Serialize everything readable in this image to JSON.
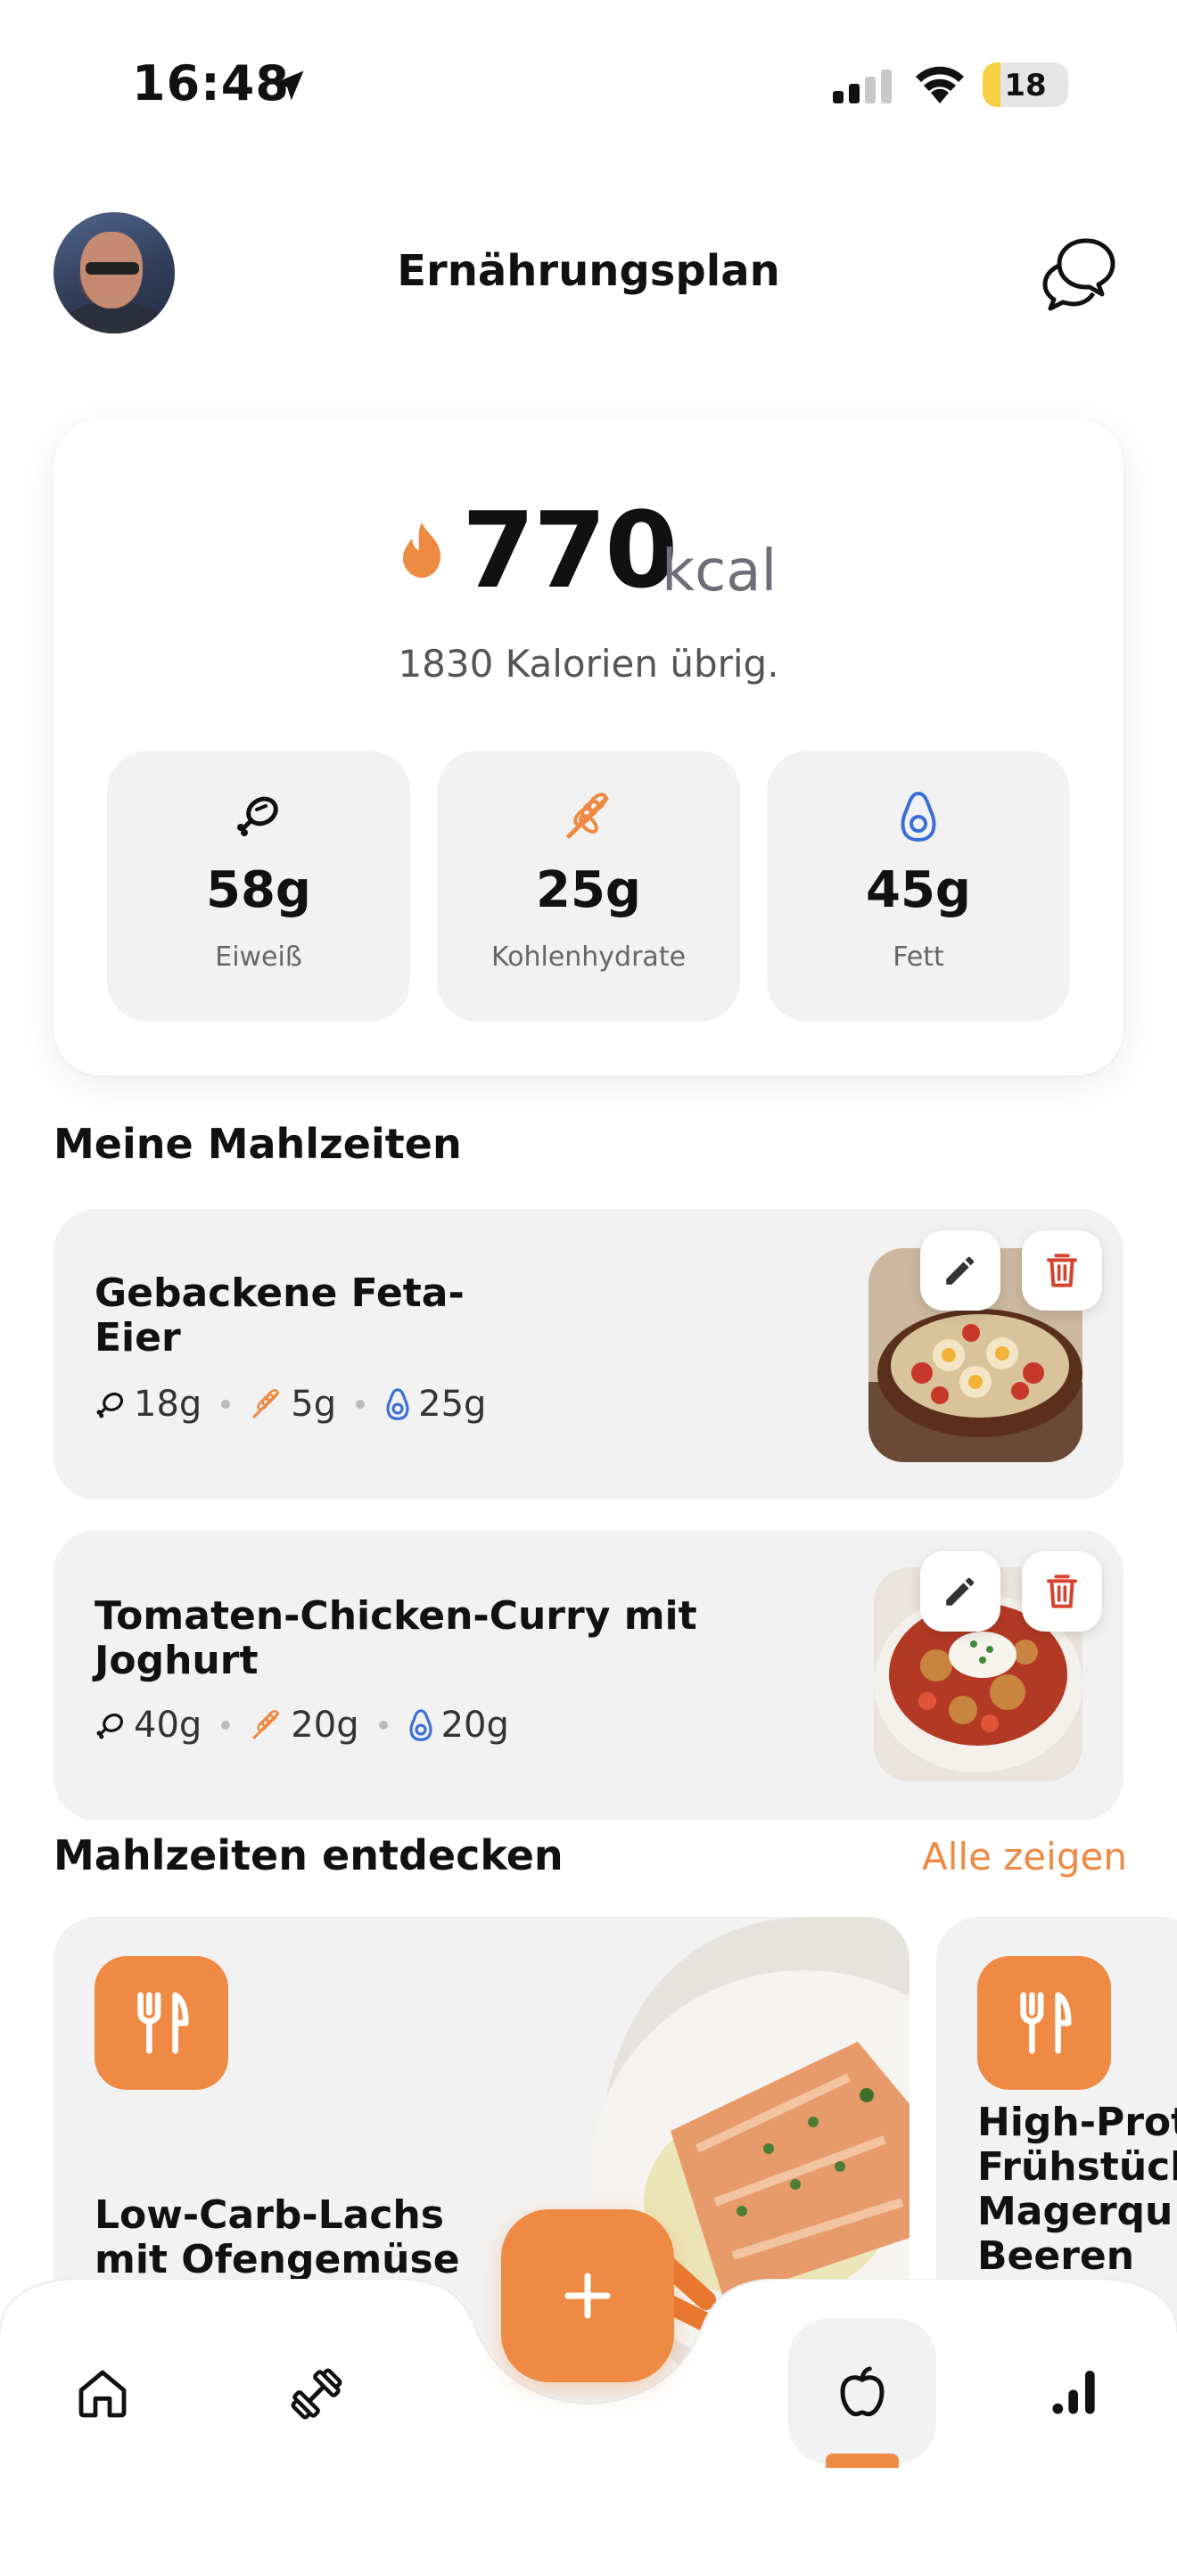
{
  "status_bar": {
    "time": "16:48",
    "battery": "18"
  },
  "header": {
    "title": "Ernährungsplan"
  },
  "calories": {
    "value": "770",
    "unit": "kcal",
    "remaining": "1830 Kalorien übrig."
  },
  "macros": [
    {
      "value": "58g",
      "label": "Eiweiß",
      "icon": "protein-icon"
    },
    {
      "value": "25g",
      "label": "Kohlenhydrate",
      "icon": "carbs-icon"
    },
    {
      "value": "45g",
      "label": "Fett",
      "icon": "fat-icon"
    }
  ],
  "my_meals": {
    "title": "Meine Mahlzeiten",
    "items": [
      {
        "name_line1": "Gebackene Feta-",
        "name_line2": "Eier",
        "protein": "18g",
        "carbs": "5g",
        "fat": "25g"
      },
      {
        "name_line1": "Tomaten-Chicken-Curry mit",
        "name_line2": "Joghurt",
        "protein": "40g",
        "carbs": "20g",
        "fat": "20g"
      }
    ]
  },
  "discover": {
    "title": "Mahlzeiten entdecken",
    "see_all": "Alle zeigen",
    "items": [
      {
        "line1": "Low-Carb-Lachs",
        "line2": "mit Ofengemüse"
      },
      {
        "line1": "High-Prot",
        "line2": "Frühstück",
        "line3": "Magerqu",
        "line4": "Beeren"
      }
    ]
  },
  "colors": {
    "accent": "#ee8a43",
    "fat_blue": "#3b6fd6",
    "delete_red": "#d8432f"
  }
}
